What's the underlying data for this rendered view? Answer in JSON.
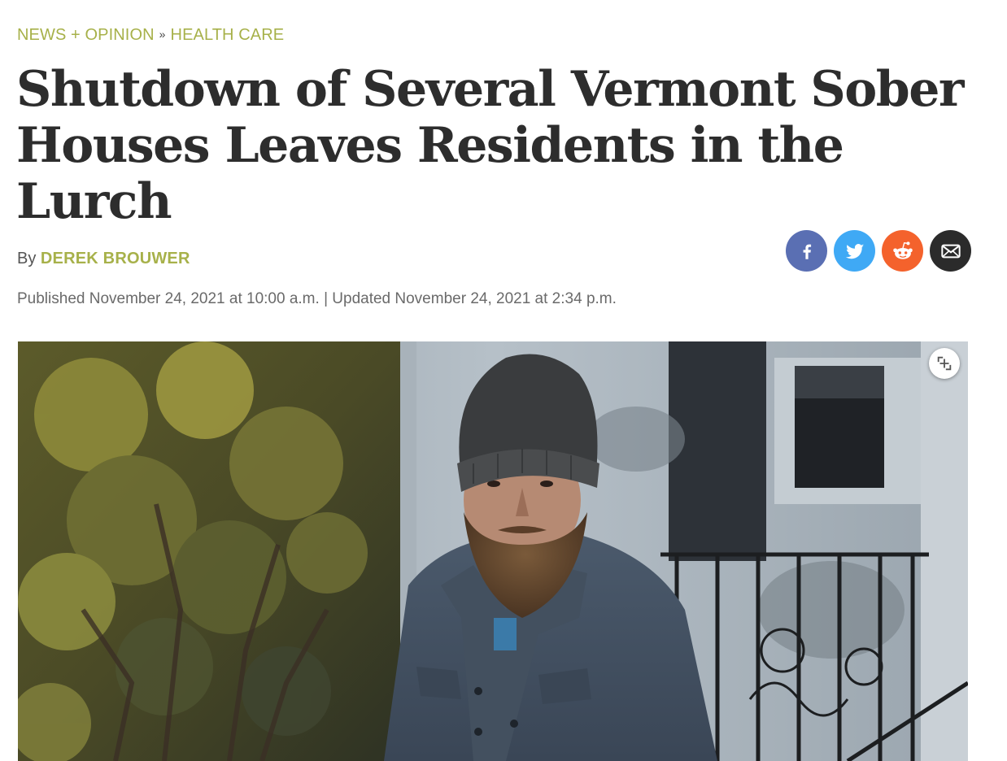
{
  "breadcrumb": {
    "section": "NEWS + OPINION",
    "separator": "»",
    "category": "HEALTH CARE"
  },
  "article": {
    "title": "Shutdown of Several Vermont Sober Houses Leaves Residents in the Lurch",
    "by_prefix": "By",
    "author": "DEREK BROUWER",
    "dates": "Published November 24, 2021 at 10:00 a.m. | Updated November 24, 2021 at 2:34 p.m."
  },
  "share": [
    {
      "icon": "facebook-icon",
      "color": "#5a6fb3"
    },
    {
      "icon": "twitter-icon",
      "color": "#3fa9f5"
    },
    {
      "icon": "reddit-icon",
      "color": "#f4622c"
    },
    {
      "icon": "email-icon",
      "color": "#2b2b2b"
    }
  ],
  "hero_image": {
    "icon": "expand-icon"
  },
  "colors": {
    "accent": "#a7b14a",
    "headline": "#2d2d2d",
    "meta": "#6a6a6a"
  }
}
